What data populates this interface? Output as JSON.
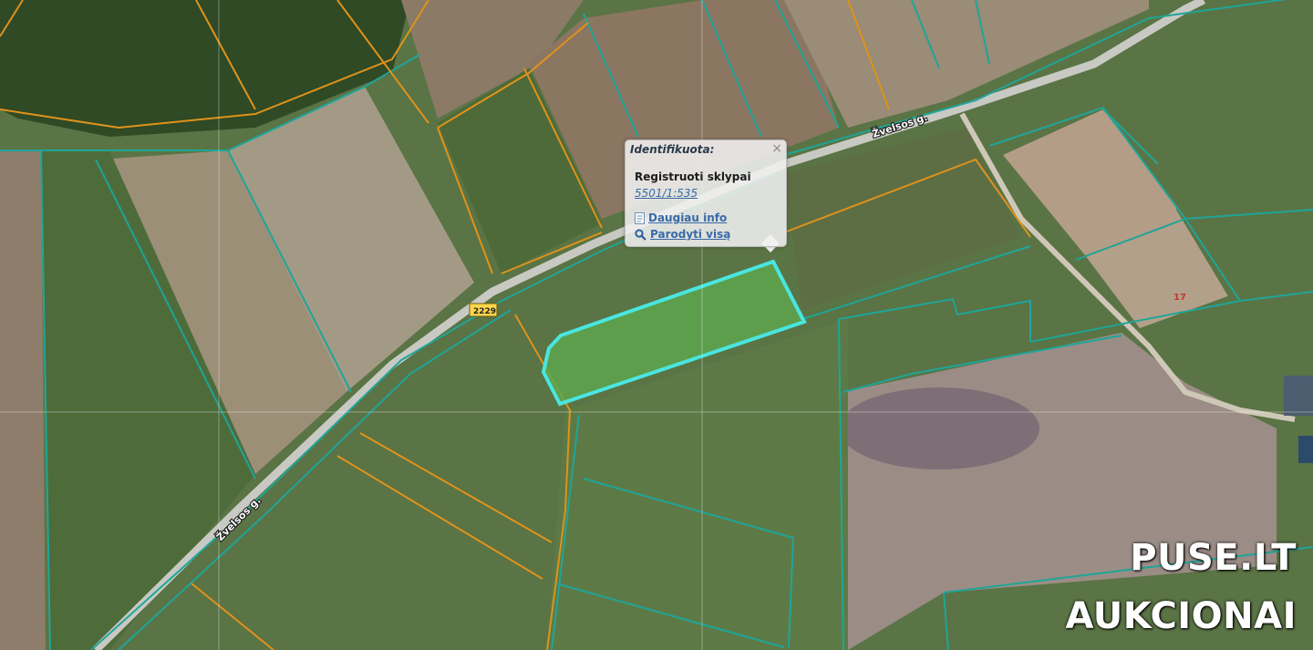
{
  "map": {
    "roads": [
      {
        "name": "Žvelsos g."
      },
      {
        "name": "Žvelsos g."
      }
    ],
    "road_number": "2229",
    "parcel_number": "17"
  },
  "popup": {
    "title": "Identifikuota:",
    "close_label": "×",
    "section_label": "Registruoti sklypai",
    "parcel_id": "5501/1:535",
    "more_info_label": "Daugiau info",
    "show_all_label": "Parodyti visą"
  },
  "watermark": {
    "line1": "PUSE.LT",
    "line2": "AUKCIONAI"
  },
  "colors": {
    "parcel_boundary": "#1fa598",
    "cadastral_orange": "#e0921a",
    "selected_outline": "#49e6e0",
    "link": "#3a6aa8"
  }
}
